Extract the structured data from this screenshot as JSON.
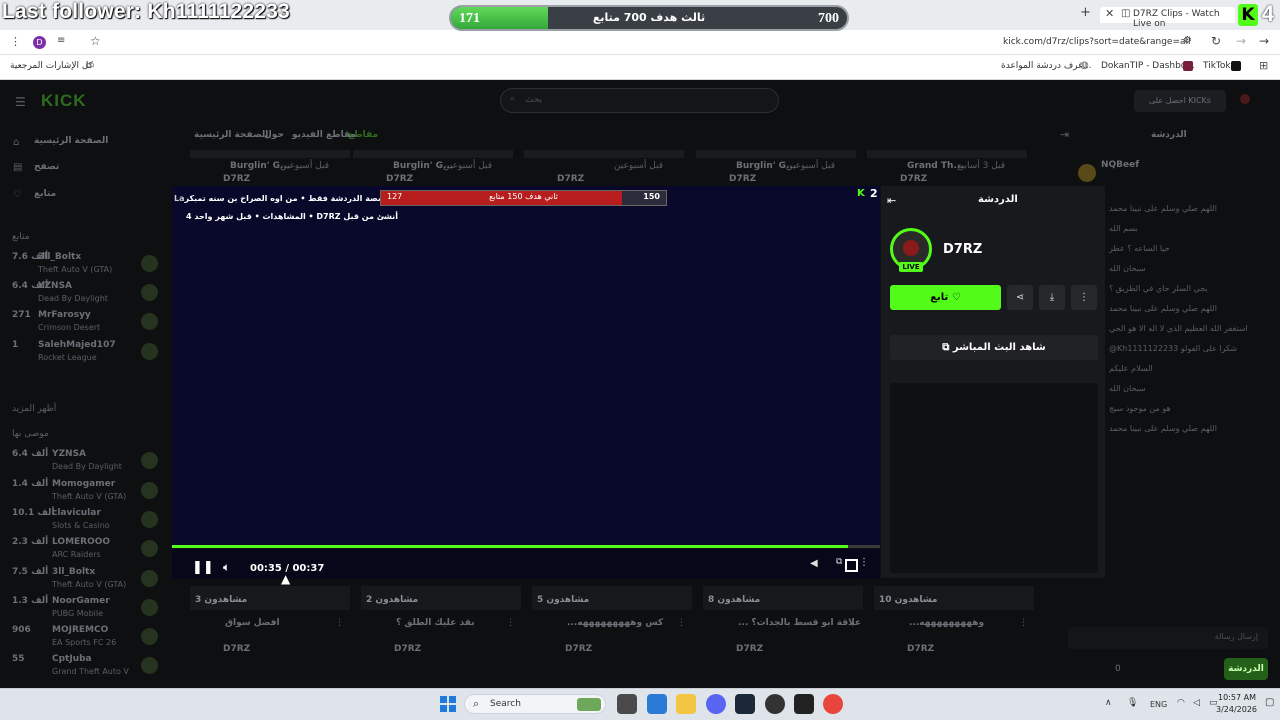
{
  "browser": {
    "tab_title": "D7RZ Clips - Watch Live on",
    "url": "kick.com/d7rz/clips?sort=date&range=all",
    "profile_initial": "D",
    "bookmarks": [
      "كل الإشارات المرجعية",
      "غرف دردشة المواعدة...",
      "DokanTIP - Dashbo...",
      "TikTok"
    ]
  },
  "overlay": {
    "last_follower": "Last follower: Kh1111122233",
    "goal_label": "ثالث هدف 700 متابع",
    "goal_current": "171",
    "goal_target": "700",
    "goal_progress": 0.244,
    "counter": "4"
  },
  "kick": {
    "logo": "KICK",
    "search_placeholder": "بحث",
    "get_kicks": "احصل على KICKs",
    "chat_header": "الدردشة",
    "nav": [
      "الصفحة الرئيسية",
      "تصفح",
      "متابع"
    ],
    "following_header": "متابع",
    "followed": [
      {
        "name": "3ll_Boltx",
        "game": "Theft Auto V (GTA)",
        "viewers": "7.6 ألف"
      },
      {
        "name": "YZNSA",
        "game": "Dead By Daylight",
        "viewers": "6.4 ألف"
      },
      {
        "name": "MrFarosyy",
        "game": "Crimson Desert",
        "viewers": "271"
      },
      {
        "name": "SalehMajed107",
        "game": "Rocket League",
        "viewers": "1"
      }
    ],
    "show_more": "أظهر المزيد",
    "recommended_header": "موصى بها",
    "recommended": [
      {
        "name": "YZNSA",
        "game": "Dead By Daylight",
        "viewers": "6.4 ألف"
      },
      {
        "name": "Momogamer",
        "game": "Theft Auto V (GTA)",
        "viewers": "1.4 ألف"
      },
      {
        "name": "clavicular",
        "game": "Slots & Casino",
        "viewers": "10.1 ألف"
      },
      {
        "name": "LOMEROOO",
        "game": "ARC Raiders",
        "viewers": "2.3 ألف"
      },
      {
        "name": "3ll_Boltx",
        "game": "Theft Auto V (GTA)",
        "viewers": "7.5 ألف"
      },
      {
        "name": "NoorGamer",
        "game": "PUBG Mobile",
        "viewers": "1.3 ألف"
      },
      {
        "name": "MOJREMCO",
        "game": "EA Sports FC 26",
        "viewers": "906"
      },
      {
        "name": "CptJuba",
        "game": "Grand Theft Auto V",
        "viewers": "55"
      }
    ],
    "channel_tabs": [
      "مقاطع",
      "مقاطع الفيديو",
      "حول",
      "الصفحة الرئيسية"
    ],
    "top_clips": [
      {
        "title": "Burglin' G...",
        "time": "قبل أسبوعين",
        "author": "D7RZ"
      },
      {
        "title": "Burglin' G...",
        "time": "قبل أسبوعين",
        "author": "D7RZ"
      },
      {
        "title": "",
        "time": "قبل أسبوعين",
        "author": "D7RZ"
      },
      {
        "title": "Burglin' G...",
        "time": "قبل أسبوعين",
        "author": "D7RZ"
      },
      {
        "title": "Grand Th...",
        "time": "قبل 3 أسابيع",
        "author": "D7RZ"
      }
    ],
    "bottom_clips": [
      {
        "views": "3 مشاهدون",
        "title": "افضل سواق",
        "author": "D7RZ"
      },
      {
        "views": "2 مشاهدون",
        "title": "بقد عليك الطلق ؟",
        "author": "D7RZ"
      },
      {
        "views": "5 مشاهدون",
        "title": "...كس وهههههههههه",
        "author": "D7RZ"
      },
      {
        "views": "8 مشاهدون",
        "title": "... علاقة ابو قسط بالجدات؟",
        "author": "D7RZ"
      },
      {
        "views": "10 مشاهدون",
        "title": "...وهههههههههه",
        "author": "D7RZ"
      }
    ]
  },
  "player": {
    "clip_title": "مخصصة الدردشة فقط • من اوه الصراخ بن سنه تمبكر",
    "clip_prefix": "La",
    "clip_meta": "المشاهدات • قبل شهر واحد 4 • D7RZ أنشئ من قبل",
    "goal_label": "ثاني هدف 150 متابع",
    "goal_current": "127",
    "goal_target": "150",
    "goal_progress": 0.847,
    "time": "00:35 / 00:37",
    "progress": 0.955,
    "kick_count": "2"
  },
  "chat_panel": {
    "title": "الدردشة",
    "channel": "D7RZ",
    "live": "LIVE",
    "follow": "تابع",
    "watch_live": "شاهد البث المباشر"
  },
  "right_chat": {
    "top_user": "NQBeef",
    "messages": [
      "اللهم صلي وسلم على نبينا محمد",
      "بسم الله",
      "حيا الساعه ؟ عطر",
      "سبحان الله",
      "يجي السلر حاي في الطريق ؟",
      "اللهم صلي وسلم على نبينا محمد",
      "استغفر الله العظيم الذي لا اله الا هو الحي",
      "@Kh1111122233 شكرا على الفولو",
      "السلام عليكم",
      "سبحان الله",
      "هو من موجود سيج",
      "اللهم صلي وسلم على نبينا محمد"
    ],
    "send": "الدردشة",
    "input_placeholder": "إرسال رسالة",
    "count": "0"
  },
  "taskbar": {
    "search": "Search",
    "lang": "ENG",
    "time": "10:57 AM",
    "date": "3/24/2026"
  }
}
